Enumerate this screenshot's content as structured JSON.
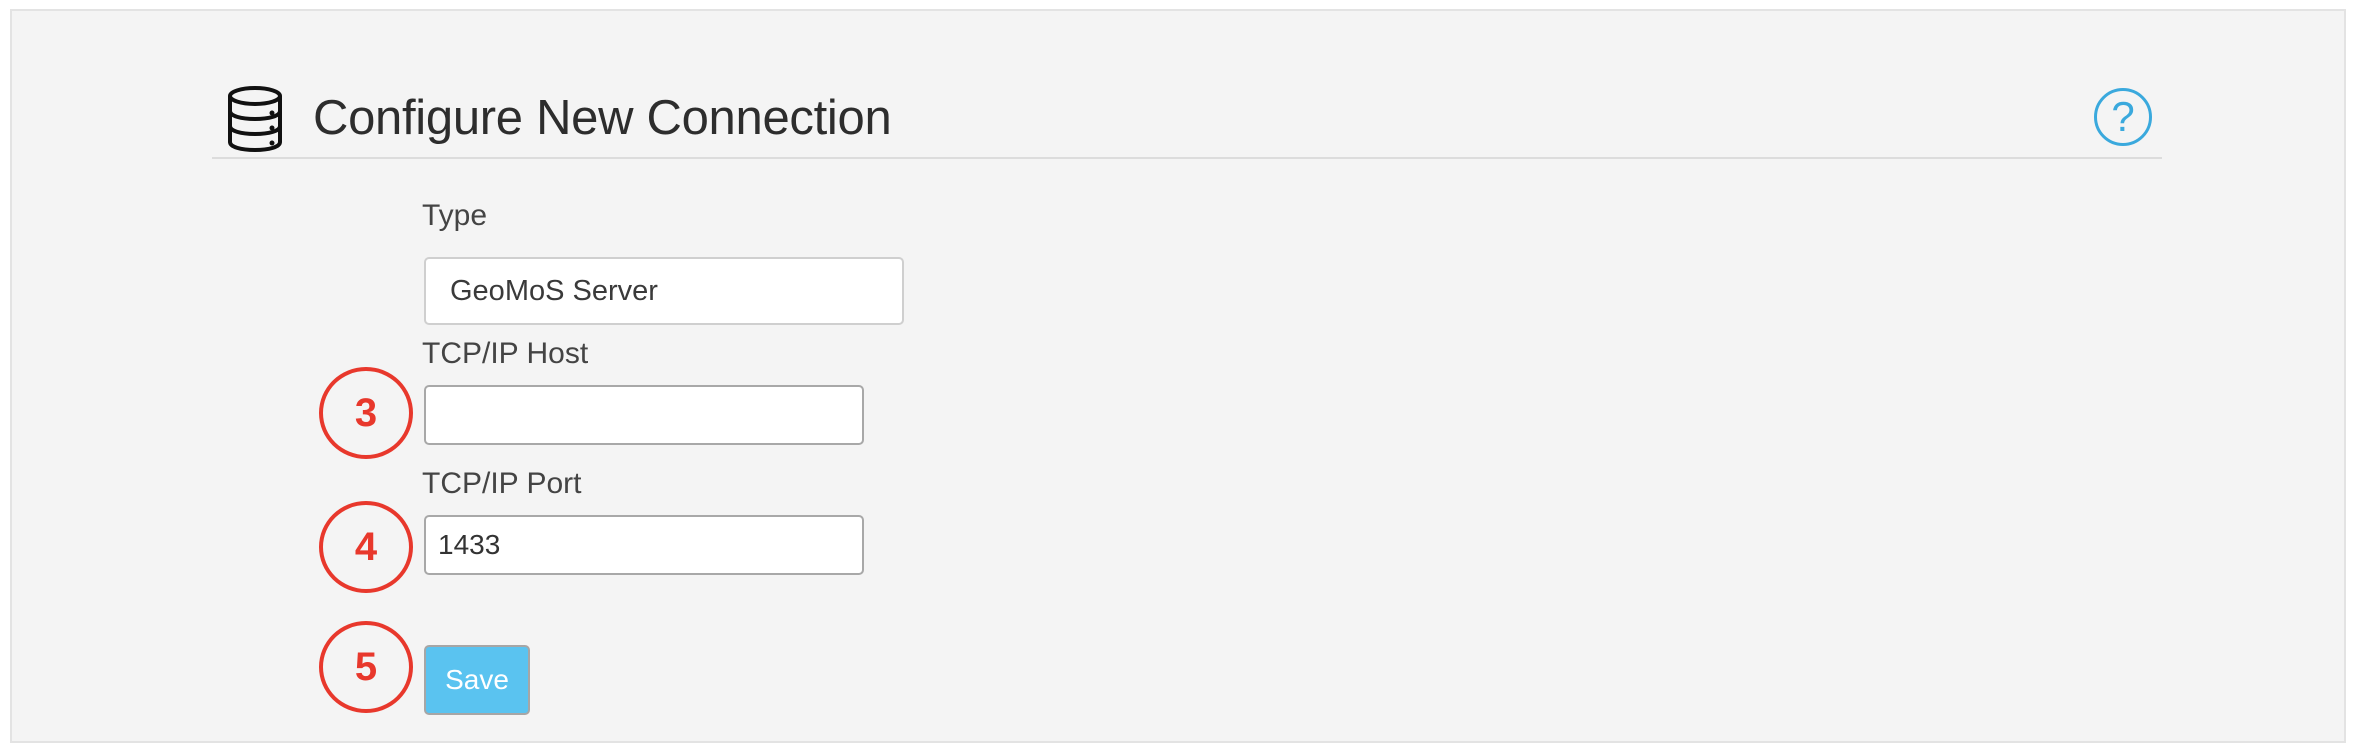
{
  "header": {
    "title": "Configure New Connection",
    "icon": "database-icon",
    "help_icon": "help-icon",
    "help_label": "?",
    "accent_color": "#3aa9dd"
  },
  "form": {
    "type_label": "Type",
    "type_value": "GeoMoS Server",
    "host_label": "TCP/IP Host",
    "host_value": "",
    "port_label": "TCP/IP Port",
    "port_value": "1433",
    "save_label": "Save",
    "save_color": "#5ac3f0"
  },
  "annotations": {
    "marker_color": "#e8382c",
    "host_marker": "3",
    "port_marker": "4",
    "save_marker": "5"
  }
}
